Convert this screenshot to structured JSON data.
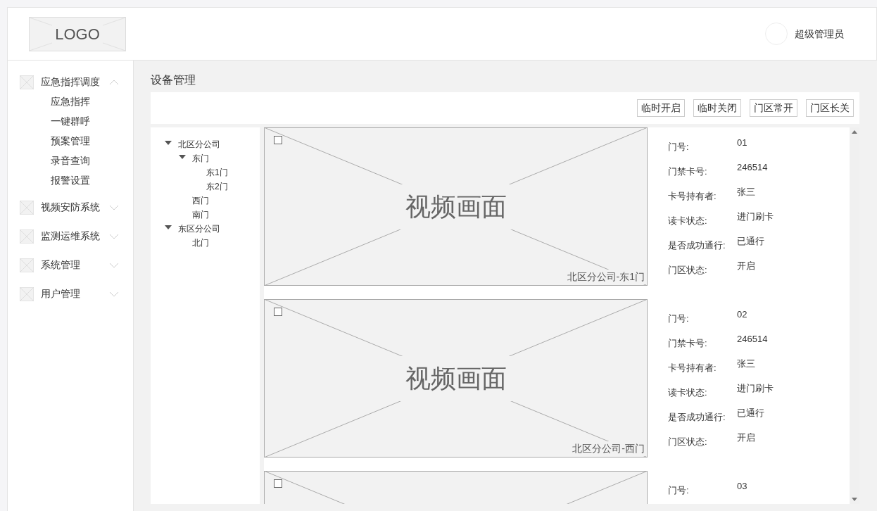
{
  "header": {
    "logo": "LOGO",
    "user": "超级管理员"
  },
  "sidebar": {
    "items": [
      {
        "label": "应急指挥调度",
        "expanded": true,
        "children": [
          {
            "label": "应急指挥"
          },
          {
            "label": "一键群呼"
          },
          {
            "label": "预案管理"
          },
          {
            "label": "录音查询"
          },
          {
            "label": "报警设置"
          }
        ]
      },
      {
        "label": "视频安防系统",
        "expanded": false
      },
      {
        "label": "监测运维系统",
        "expanded": false
      },
      {
        "label": "系统管理",
        "expanded": false
      },
      {
        "label": "用户管理",
        "expanded": false
      }
    ]
  },
  "page_title": "设备管理",
  "toolbar": {
    "buttons": [
      "临时开启",
      "临时关闭",
      "门区常开",
      "门区长关"
    ]
  },
  "tree": [
    {
      "label": "北区分公司",
      "expanded": true,
      "children": [
        {
          "label": "东门",
          "expanded": true,
          "children": [
            {
              "label": "东1门"
            },
            {
              "label": "东2门"
            }
          ]
        },
        {
          "label": "西门"
        },
        {
          "label": "南门"
        }
      ]
    },
    {
      "label": "东区分公司",
      "expanded": true,
      "children": [
        {
          "label": "北门"
        }
      ]
    }
  ],
  "cameras": [
    {
      "checked": false,
      "title": "视频画面",
      "caption": "北区分公司-东1门",
      "fields": [
        {
          "label": "门号:",
          "value": "01"
        },
        {
          "label": "门禁卡号:",
          "value": "246514"
        },
        {
          "label": "卡号持有者:",
          "value": "张三"
        },
        {
          "label": "读卡状态:",
          "value": "进门刷卡"
        },
        {
          "label": "是否成功通行:",
          "value": "已通行"
        },
        {
          "label": "门区状态:",
          "value": "开启"
        }
      ]
    },
    {
      "checked": false,
      "title": "视频画面",
      "caption": "北区分公司-西门",
      "fields": [
        {
          "label": "门号:",
          "value": "02"
        },
        {
          "label": "门禁卡号:",
          "value": "246514"
        },
        {
          "label": "卡号持有者:",
          "value": "张三"
        },
        {
          "label": "读卡状态:",
          "value": "进门刷卡"
        },
        {
          "label": "是否成功通行:",
          "value": "已通行"
        },
        {
          "label": "门区状态:",
          "value": "开启"
        }
      ]
    },
    {
      "checked": false,
      "fields": [
        {
          "label": "门号:",
          "value": "03"
        }
      ]
    }
  ]
}
